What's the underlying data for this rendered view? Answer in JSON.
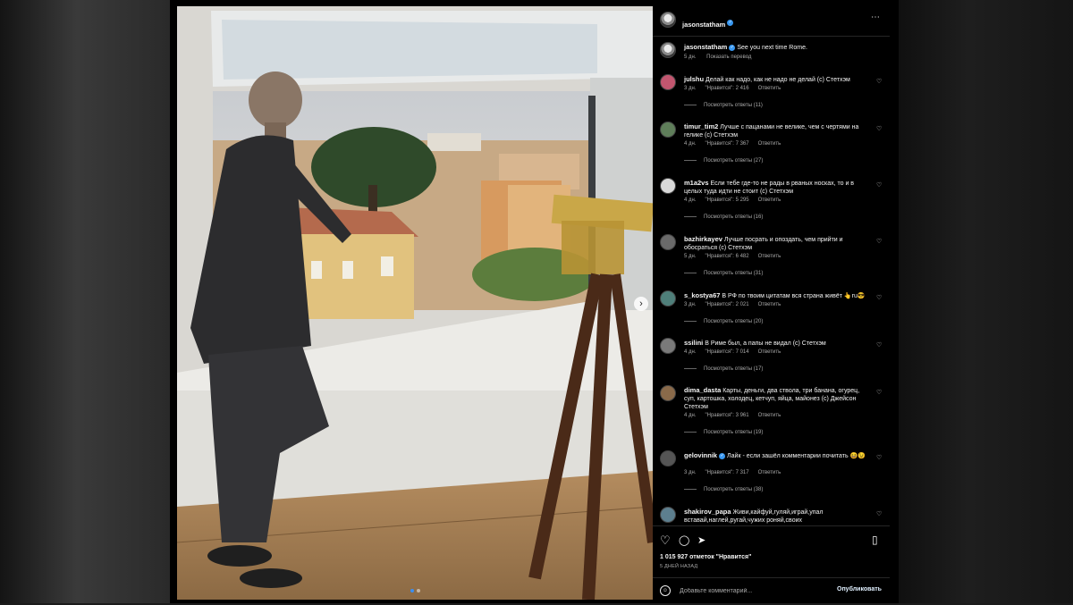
{
  "post": {
    "author": "jasonstatham",
    "caption": "See you next time Rome.",
    "caption_age": "5 дн.",
    "translate_label": "Показать перевод",
    "likes_text": "1 015 927 отметок \"Нравится\"",
    "date_text": "5 ДНЕЙ НАЗАД",
    "more_icon": "⋯",
    "next_icon": "›",
    "carousel_count": 2,
    "carousel_active": 1
  },
  "comment_labels": {
    "reply": "Ответить",
    "like_icon": "♡"
  },
  "comments": [
    {
      "user": "julshu",
      "verified": false,
      "text": "Делай как надо, как не надо не делай (с) Стетхэм",
      "age": "3 дн.",
      "likes": "\"Нравится\": 2 416",
      "replies": "Посмотреть ответы (11)",
      "avatar_color": "#c2566f"
    },
    {
      "user": "timur_tim2",
      "verified": false,
      "text": "Лучше с пацанами не велике, чем с чертями на гелике (с) Стетхэм",
      "age": "4 дн.",
      "likes": "\"Нравится\": 7 367",
      "replies": "Посмотреть ответы (27)",
      "avatar_color": "#5f7e5a"
    },
    {
      "user": "m1a2vs",
      "verified": false,
      "text": "Если тебе где-то не рады в рваных носках, то и в целых туда идти не стоит (с) Стетхэм",
      "age": "4 дн.",
      "likes": "\"Нравится\": 5 295",
      "replies": "Посмотреть ответы (16)",
      "avatar_color": "#d9d9d9"
    },
    {
      "user": "bazhirkayev",
      "verified": false,
      "text": "Лучше посрать и опоздать, чем прийти и обосраться (с) Стетхэм",
      "age": "5 дн.",
      "likes": "\"Нравится\": 6 482",
      "replies": "Посмотреть ответы (31)",
      "avatar_color": "#6a6a6a"
    },
    {
      "user": "s_kostya67",
      "verified": false,
      "text": "В РФ по твоим цитатам вся страна живёт 👆ru😎",
      "age": "3 дн.",
      "likes": "\"Нравится\": 2 021",
      "replies": "Посмотреть ответы (20)",
      "avatar_color": "#4f7f7a"
    },
    {
      "user": "ssilini",
      "verified": false,
      "text": "В Риме был, а папы не видал (с) Стетхэм",
      "age": "4 дн.",
      "likes": "\"Нравится\": 7 014",
      "replies": "Посмотреть ответы (17)",
      "avatar_color": "#7a7a7a"
    },
    {
      "user": "dima_dasta",
      "verified": false,
      "text": "Карты, деньги, два ствола, три банана, огурец, суп, картошка, холодец, кетчуп, яйца, майонез (с) Джейсон Стетхэм",
      "age": "4 дн.",
      "likes": "\"Нравится\": 3 961",
      "replies": "Посмотреть ответы (19)",
      "avatar_color": "#8a6a4a"
    },
    {
      "user": "gelovinnik",
      "verified": true,
      "text": "Лайк - если зашёл комментарии почитать 😆😉",
      "age": "3 дн.",
      "likes": "\"Нравится\": 7 317",
      "replies": "Посмотреть ответы (38)",
      "avatar_color": "#555555"
    },
    {
      "user": "shakirov_papa",
      "verified": false,
      "text": "Живи,кайфуй,гуляй,играй,упал вставай,наглей,ругай,чужих роняй,своих",
      "age": "",
      "likes": "",
      "replies": "",
      "avatar_color": "#5d7f8f"
    }
  ],
  "actions": {
    "like_icon": "♡",
    "comment_icon": "◯",
    "share_icon": "➤",
    "save_icon": "▯"
  },
  "add_comment": {
    "emoji_icon": "☺",
    "placeholder": "Добавьте комментарий...",
    "publish_label": "Опубликовать"
  }
}
